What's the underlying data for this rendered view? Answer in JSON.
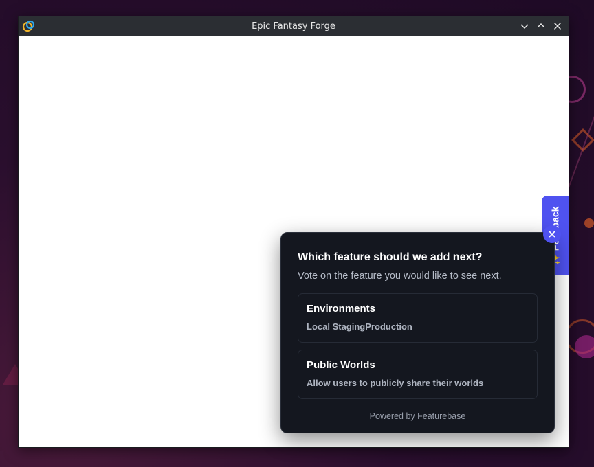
{
  "window": {
    "title": "Epic Fantasy Forge"
  },
  "feedback_tab": {
    "label": "✨ Feedback",
    "color": "#4f52f0"
  },
  "popup": {
    "title": "Which feature should we add next?",
    "subtitle": "Vote on the feature you would like to see next.",
    "features": [
      {
        "title": "Environments",
        "description": "Local StagingProduction"
      },
      {
        "title": "Public Worlds",
        "description": "Allow users to publicly share their worlds"
      }
    ],
    "footer": "Powered by Featurebase",
    "background": "#14171f"
  },
  "icons": {
    "app": "app-logo-icon",
    "minimize": "chevron-down-icon",
    "maximize": "chevron-up-icon",
    "close": "close-icon",
    "popup_close": "close-icon"
  }
}
